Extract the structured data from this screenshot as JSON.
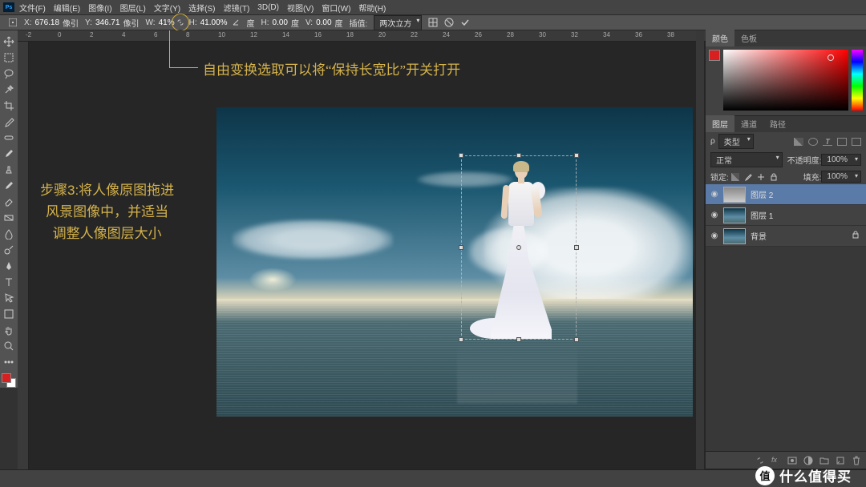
{
  "menu": [
    "文件(F)",
    "编辑(E)",
    "图像(I)",
    "图层(L)",
    "文字(Y)",
    "选择(S)",
    "滤镜(T)",
    "3D(D)",
    "视图(V)",
    "窗口(W)",
    "帮助(H)"
  ],
  "options": {
    "x_label": "X:",
    "x": "676.18",
    "x_unit": "像引",
    "y_label": "Y:",
    "y": "346.71",
    "y_unit": "像引",
    "w_label": "W:",
    "w": "41%",
    "h_label": "H:",
    "h": "41.00%",
    "deg": "度",
    "h2_label": "H:",
    "h2": "0.00",
    "deg2": "度",
    "v_label": "V:",
    "v": "0.00",
    "deg3": "度",
    "interp_label": "插值:",
    "interp": "两次立方"
  },
  "ruler_marks": [
    -2,
    0,
    2,
    4,
    6,
    8,
    10,
    12,
    14,
    16,
    18,
    20,
    22,
    24,
    26,
    28,
    30,
    32,
    34,
    36,
    38
  ],
  "annotations": {
    "top": "自由变换选取可以将“保持长宽比”开关打开",
    "left_l1": "步骤3:将人像原图拖进",
    "left_l2": "风景图像中，并适当",
    "left_l3": "调整人像图层大小"
  },
  "panels": {
    "color_tabs": [
      "颜色",
      "色板"
    ],
    "layer_tabs": [
      "图层",
      "通道",
      "路径"
    ],
    "search_placeholder": "类型",
    "blend": "正常",
    "opacity_label": "不透明度:",
    "opacity": "100%",
    "lock_label": "锁定:",
    "fill_label": "填充:",
    "fill": "100%",
    "layers": [
      {
        "name": "图层 2"
      },
      {
        "name": "图层 1"
      },
      {
        "name": "背景"
      }
    ]
  },
  "watermark": {
    "badge": "值",
    "text": "什么值得买"
  }
}
